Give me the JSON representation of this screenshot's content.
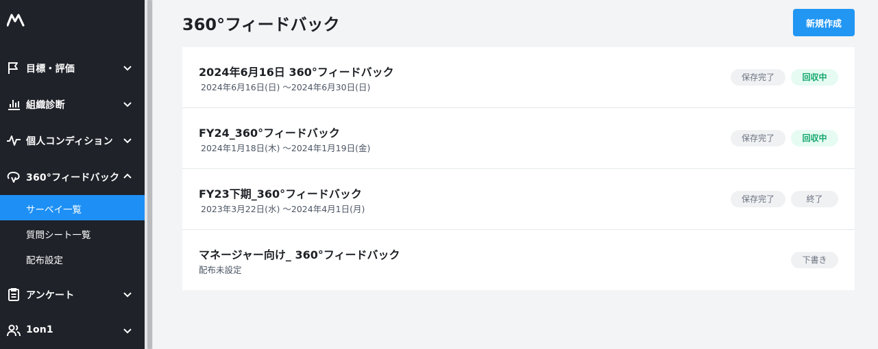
{
  "sidebar": {
    "logo_icon": "brand-logo-icon",
    "groups": [
      {
        "label": "目標・評価",
        "icon": "flag-icon",
        "expanded": false
      },
      {
        "label": "組織診断",
        "icon": "bar-chart-icon",
        "expanded": false
      },
      {
        "label": "個人コンディション",
        "icon": "pulse-icon",
        "expanded": false
      },
      {
        "label": "360°フィードバック",
        "icon": "feedback-cycle-icon",
        "expanded": true
      },
      {
        "label": "アンケート",
        "icon": "clipboard-icon",
        "expanded": false
      },
      {
        "label": "1on1",
        "icon": "users-icon",
        "expanded": false
      }
    ],
    "subitems": [
      {
        "label": "サーベイ一覧",
        "active": true
      },
      {
        "label": "質問シート一覧",
        "active": false
      },
      {
        "label": "配布設定",
        "active": false
      }
    ]
  },
  "main": {
    "title": "360°フィードバック",
    "new_button": "新規作成",
    "surveys": [
      {
        "name": "2024年6月16日 360°フィードバック",
        "period": "2024年6月16日(日) 〜2024年6月30日(日)",
        "saved_badge": "保存完了",
        "status": "回収中",
        "status_color": "green"
      },
      {
        "name": "FY24_360°フィードバック",
        "period": "2024年1月18日(木) 〜2024年1月19日(金)",
        "saved_badge": "保存完了",
        "status": "回収中",
        "status_color": "green"
      },
      {
        "name": "FY23下期_360°フィードバック",
        "period": "2023年3月22日(水) 〜2024年4月1日(月)",
        "saved_badge": "保存完了",
        "status": "終了",
        "status_color": "gray"
      },
      {
        "name": "マネージャー向け_ 360°フィードバック",
        "period": "配布未設定",
        "status": "下書き",
        "status_color": "gray"
      }
    ]
  },
  "colors": {
    "sidebar_bg": "#1f2229",
    "accent": "#2196f3",
    "active_item": "#1e90f5",
    "status_green": "#12a66b"
  }
}
